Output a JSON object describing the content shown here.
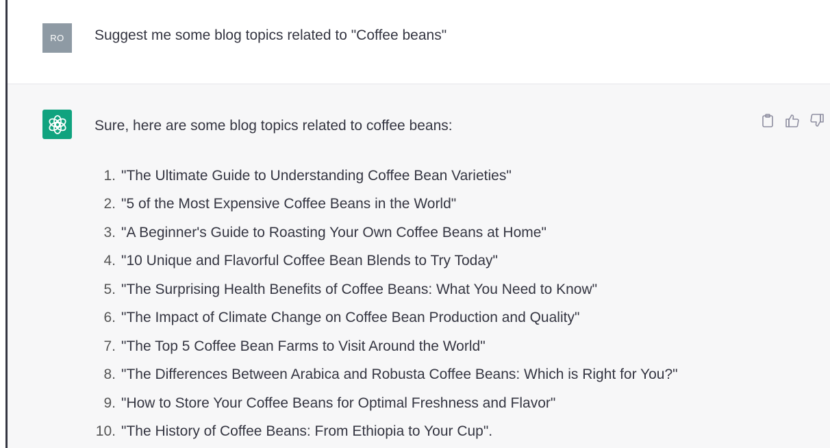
{
  "user_message": {
    "avatar_initials": "RO",
    "text": "Suggest me some blog topics related to \"Coffee beans\""
  },
  "assistant_message": {
    "intro": "Sure, here are some blog topics related to coffee beans:",
    "topics": [
      {
        "num": "1.",
        "text": "\"The Ultimate Guide to Understanding Coffee Bean Varieties\""
      },
      {
        "num": "2.",
        "text": "\"5 of the Most Expensive Coffee Beans in the World\""
      },
      {
        "num": "3.",
        "text": "\"A Beginner's Guide to Roasting Your Own Coffee Beans at Home\""
      },
      {
        "num": "4.",
        "text": "\"10 Unique and Flavorful Coffee Bean Blends to Try Today\""
      },
      {
        "num": "5.",
        "text": "\"The Surprising Health Benefits of Coffee Beans: What You Need to Know\""
      },
      {
        "num": "6.",
        "text": "\"The Impact of Climate Change on Coffee Bean Production and Quality\""
      },
      {
        "num": "7.",
        "text": "\"The Top 5 Coffee Bean Farms to Visit Around the World\""
      },
      {
        "num": "8.",
        "text": "\"The Differences Between Arabica and Robusta Coffee Beans: Which is Right for You?\""
      },
      {
        "num": "9.",
        "text": "\"How to Store Your Coffee Beans for Optimal Freshness and Flavor\""
      },
      {
        "num": "10.",
        "text": "\"The History of Coffee Beans: From Ethiopia to Your Cup\"."
      }
    ]
  },
  "icons": {
    "assistant_avatar": "openai-logo-icon",
    "copy": "clipboard-icon",
    "like": "thumbs-up-icon",
    "dislike": "thumbs-down-icon"
  },
  "colors": {
    "assistant_avatar_bg": "#10a37f",
    "user_avatar_bg": "#8e9aa4",
    "assistant_row_bg": "#f7f7f8"
  }
}
